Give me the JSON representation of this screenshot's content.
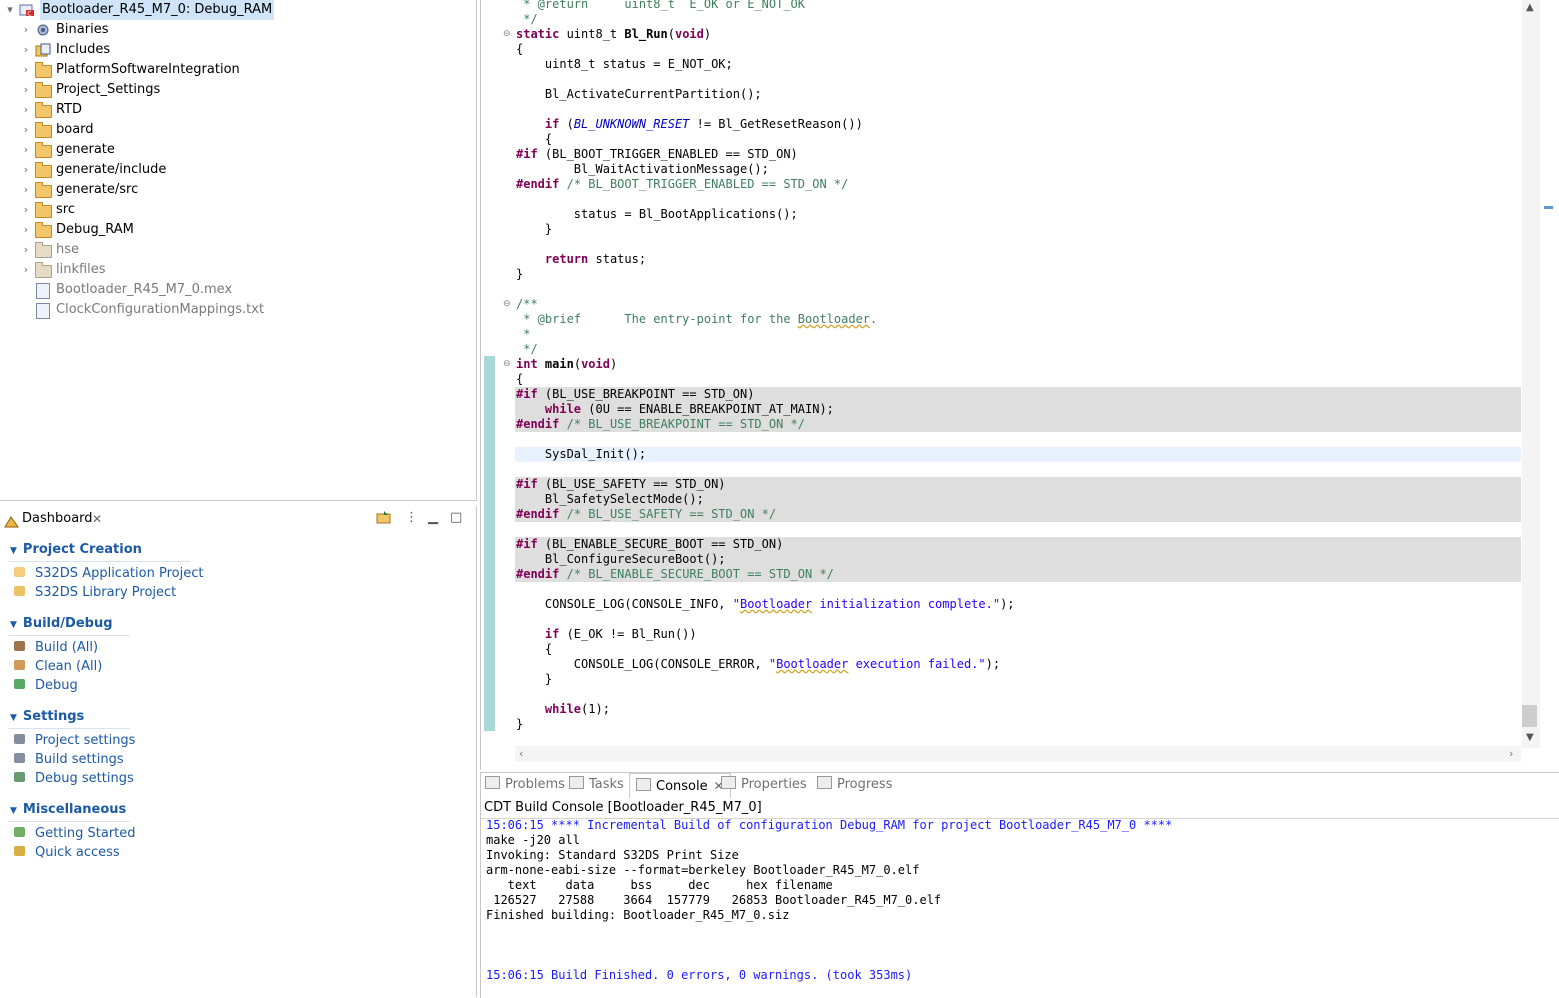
{
  "project_tree": {
    "root": "Bootloader_R45_M7_0: Debug_RAM",
    "items": [
      {
        "label": "Binaries",
        "kind": "binaries",
        "dim": false
      },
      {
        "label": "Includes",
        "kind": "includes",
        "dim": false
      },
      {
        "label": "PlatformSoftwareIntegration",
        "kind": "folder",
        "dim": false
      },
      {
        "label": "Project_Settings",
        "kind": "folder",
        "dim": false
      },
      {
        "label": "RTD",
        "kind": "folder",
        "dim": false
      },
      {
        "label": "board",
        "kind": "folder",
        "dim": false
      },
      {
        "label": "generate",
        "kind": "folder",
        "dim": false
      },
      {
        "label": "generate/include",
        "kind": "folder",
        "dim": false
      },
      {
        "label": "generate/src",
        "kind": "folder",
        "dim": false
      },
      {
        "label": "src",
        "kind": "folder",
        "dim": false
      },
      {
        "label": "Debug_RAM",
        "kind": "folder",
        "dim": false
      },
      {
        "label": "hse",
        "kind": "folder",
        "dim": true
      },
      {
        "label": "linkfiles",
        "kind": "folder",
        "dim": true
      },
      {
        "label": "Bootloader_R45_M7_0.mex",
        "kind": "file",
        "dim": true
      },
      {
        "label": "ClockConfigurationMappings.txt",
        "kind": "file",
        "dim": true
      }
    ]
  },
  "dashboard": {
    "tab_label": "Dashboard",
    "sections": [
      {
        "title": "Project Creation",
        "links": [
          {
            "label": "S32DS Application Project",
            "icon": "new-project-icon"
          },
          {
            "label": "S32DS Library Project",
            "icon": "library-icon"
          }
        ]
      },
      {
        "title": "Build/Debug",
        "links": [
          {
            "label": "Build  (All)",
            "icon": "hammer-icon"
          },
          {
            "label": "Clean  (All)",
            "icon": "broom-icon"
          },
          {
            "label": "Debug",
            "icon": "bug-icon"
          }
        ]
      },
      {
        "title": "Settings",
        "links": [
          {
            "label": "Project settings",
            "icon": "gear-icon"
          },
          {
            "label": "Build settings",
            "icon": "gear-icon"
          },
          {
            "label": "Debug settings",
            "icon": "bug-gear-icon"
          }
        ]
      },
      {
        "title": "Miscellaneous",
        "links": [
          {
            "label": "Getting Started",
            "icon": "getting-started-icon"
          },
          {
            "label": "Quick access",
            "icon": "key-icon"
          }
        ]
      }
    ]
  },
  "editor": {
    "lines": [
      {
        "html": " <span class=\"cmi\">* @return     uint8_t  E_OK or E_NOT_OK</span>"
      },
      {
        "html": " <span class=\"cm\">*/</span>"
      },
      {
        "html": "<span class=\"kw\">static</span> uint8_t <span class=\"fnb\">Bl_Run</span>(<span class=\"kw\">void</span>)",
        "fold": "⊖"
      },
      {
        "html": "{"
      },
      {
        "html": "    uint8_t status = E_NOT_OK;"
      },
      {
        "html": ""
      },
      {
        "html": "    Bl_ActivateCurrentPartition();"
      },
      {
        "html": ""
      },
      {
        "html": "    <span class=\"kw\">if</span> (<span class=\"mac\">BL_UNKNOWN_RESET</span> != Bl_GetResetReason())"
      },
      {
        "html": "    {"
      },
      {
        "html": "<span class=\"pp\">#if</span> (BL_BOOT_TRIGGER_ENABLED == STD_ON)"
      },
      {
        "html": "        Bl_WaitActivationMessage();"
      },
      {
        "html": "<span class=\"pp\">#endif</span> <span class=\"cm\">/* BL_BOOT_TRIGGER_ENABLED == STD_ON */</span>"
      },
      {
        "html": ""
      },
      {
        "html": "        status = Bl_BootApplications();"
      },
      {
        "html": "    }"
      },
      {
        "html": "",
        "half": true
      },
      {
        "html": "    <span class=\"kw\">return</span> status;"
      },
      {
        "html": "}"
      },
      {
        "html": "",
        "half": true
      },
      {
        "html": "<span class=\"cm\">/**</span>",
        "fold": "⊖"
      },
      {
        "html": " <span class=\"cm\">* @brief      The entry-point for the <span class=\"sq\">Bootloader</span>.</span>"
      },
      {
        "html": " <span class=\"cm\">*</span>"
      },
      {
        "html": " <span class=\"cm\">*/</span>"
      },
      {
        "html": "<span class=\"kw\">int</span> <span class=\"fnb\">main</span>(<span class=\"kw\">void</span>)",
        "fold": "⊖"
      },
      {
        "html": "{"
      },
      {
        "html": "<span class=\"pp\">#if</span> (BL_USE_BREAKPOINT == STD_ON)",
        "grey": true
      },
      {
        "html": "    <span class=\"kw\">while</span> (0U == ENABLE_BREAKPOINT_AT_MAIN);",
        "grey": true
      },
      {
        "html": "<span class=\"pp\">#endif</span> <span class=\"cm\">/* BL_USE_BREAKPOINT == STD_ON */</span>",
        "grey": true
      },
      {
        "html": ""
      },
      {
        "html": "    SysDal_Init();",
        "cur": true
      },
      {
        "html": ""
      },
      {
        "html": "<span class=\"pp\">#if</span> (BL_USE_SAFETY == STD_ON)",
        "grey": true
      },
      {
        "html": "    Bl_SafetySelectMode();",
        "grey": true
      },
      {
        "html": "<span class=\"pp\">#endif</span> <span class=\"cm\">/* BL_USE_SAFETY == STD_ON */</span>",
        "grey": true
      },
      {
        "html": ""
      },
      {
        "html": "<span class=\"pp\">#if</span> (BL_ENABLE_SECURE_BOOT == STD_ON)",
        "grey": true
      },
      {
        "html": "    Bl_ConfigureSecureBoot();",
        "grey": true
      },
      {
        "html": "<span class=\"pp\">#endif</span> <span class=\"cm\">/* BL_ENABLE_SECURE_BOOT == STD_ON */</span>",
        "grey": true
      },
      {
        "html": ""
      },
      {
        "html": "    CONSOLE_LOG(CONSOLE_INFO, <span class=\"str\">\"<span class=\"sq\">Bootloader</span> initialization complete.\"</span>);"
      },
      {
        "html": ""
      },
      {
        "html": "    <span class=\"kw\">if</span> (E_OK != Bl_Run())"
      },
      {
        "html": "    {"
      },
      {
        "html": "        CONSOLE_LOG(CONSOLE_ERROR, <span class=\"str\">\"<span class=\"sq\">Bootloader</span> execution failed.\"</span>);"
      },
      {
        "html": "    }"
      },
      {
        "html": "",
        "half": true
      },
      {
        "html": "    <span class=\"kw\">while</span>(1);"
      },
      {
        "html": "}"
      }
    ]
  },
  "console": {
    "tabs": [
      {
        "label": "Problems",
        "active": false
      },
      {
        "label": "Tasks",
        "active": false
      },
      {
        "label": "Console",
        "active": true
      },
      {
        "label": "Properties",
        "active": false
      },
      {
        "label": "Progress",
        "active": false
      }
    ],
    "title": "CDT Build Console [Bootloader_R45_M7_0]",
    "lines": [
      {
        "text": "15:06:15 **** Incremental Build of configuration Debug_RAM for project Bootloader_R45_M7_0 ****",
        "blue": true
      },
      {
        "text": "make -j20 all",
        "blue": false
      },
      {
        "text": "Invoking: Standard S32DS Print Size",
        "blue": false
      },
      {
        "text": "arm-none-eabi-size --format=berkeley Bootloader_R45_M7_0.elf",
        "blue": false
      },
      {
        "text": "   text    data     bss     dec     hex filename",
        "blue": false
      },
      {
        "text": " 126527   27588    3664  157779   26853 Bootloader_R45_M7_0.elf",
        "blue": false
      },
      {
        "text": "Finished building: Bootloader_R45_M7_0.siz",
        "blue": false
      },
      {
        "text": "",
        "blue": false
      },
      {
        "text": "",
        "blue": false
      },
      {
        "text": "",
        "blue": false
      },
      {
        "text": "15:06:15 Build Finished. 0 errors, 0 warnings. (took 353ms)",
        "blue": true
      }
    ]
  }
}
